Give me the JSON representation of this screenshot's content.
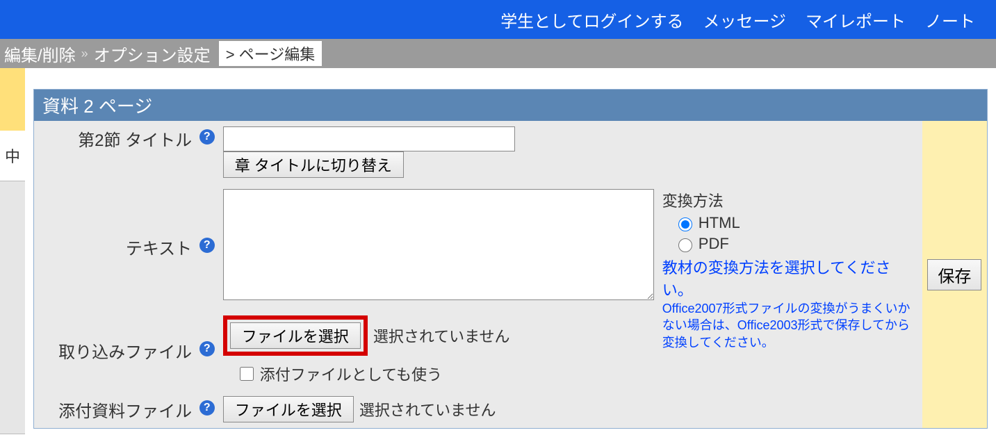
{
  "topbar": {
    "login_as_student": "学生としてログインする",
    "messages": "メッセージ",
    "my_report": "マイレポート",
    "notes": "ノート"
  },
  "breadcrumb": {
    "edit_delete": "編集/削除",
    "option_settings": "オプション設定",
    "page_edit": "ページ編集",
    "sep": "»",
    "prefix": ">"
  },
  "left": {
    "status_char": "中"
  },
  "panel": {
    "title": "資料 2 ページ"
  },
  "labels": {
    "section_title": "第2節 タイトル",
    "text": "テキスト",
    "import_file": "取り込みファイル",
    "attachment_file": "添付資料ファイル"
  },
  "buttons": {
    "switch_to_chapter": "章 タイトルに切り替え",
    "choose_file": "ファイルを選択",
    "save": "保存"
  },
  "file": {
    "no_file_selected": "選択されていません",
    "use_as_attachment": "添付ファイルとしても使う"
  },
  "conversion": {
    "method_label": "変換方法",
    "html": "HTML",
    "pdf": "PDF",
    "link": "教材の変換方法を選択してください。",
    "note": "Office2007形式ファイルの変換がうまくいかない場合は、Office2003形式で保存してから変換してください。"
  },
  "help_glyph": "?"
}
